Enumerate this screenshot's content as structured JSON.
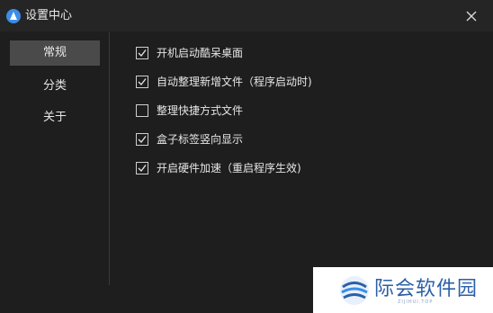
{
  "window": {
    "title": "设置中心",
    "icon": "app-logo-icon",
    "close_icon": "close-icon"
  },
  "sidebar": {
    "items": [
      {
        "label": "常规",
        "active": true
      },
      {
        "label": "分类",
        "active": false
      },
      {
        "label": "关于",
        "active": false
      }
    ]
  },
  "options": [
    {
      "label": "开机启动酷呆桌面",
      "checked": true
    },
    {
      "label": "自动整理新增文件（程序启动时)",
      "checked": true
    },
    {
      "label": "整理快捷方式文件",
      "checked": false
    },
    {
      "label": "盒子标签竖向显示",
      "checked": true
    },
    {
      "label": "开启硬件加速（重启程序生效)",
      "checked": true
    }
  ],
  "watermark": {
    "text": "际会软件园",
    "subtext": "ZIJIHUI.TOP"
  },
  "colors": {
    "background": "#1e1e1e",
    "titlebar": "#252525",
    "active_nav": "#4a4a4a",
    "accent": "#3b8de8"
  }
}
